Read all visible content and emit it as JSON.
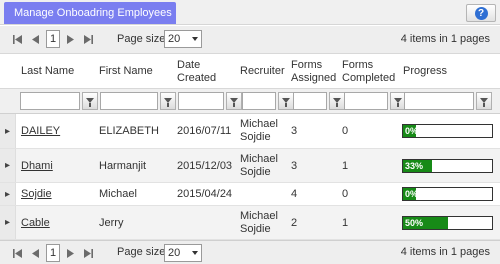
{
  "title_tab": "Manage Onboadring Employees",
  "pager": {
    "current_page": "1",
    "page_size_label": "Page size:",
    "page_size_value": "20",
    "info": "4 items in 1 pages"
  },
  "columns": {
    "last_name": "Last Name",
    "first_name": "First Name",
    "date_created_1": "Date",
    "date_created_2": "Created",
    "recruiter": "Recruiter",
    "forms_assigned_1": "Forms",
    "forms_assigned_2": "Assigned",
    "forms_completed_1": "Forms",
    "forms_completed_2": "Completed",
    "progress": "Progress"
  },
  "rows": [
    {
      "last_name": "DAILEY",
      "first_name": "ELIZABETH",
      "date_created": "2016/07/11",
      "recruiter_1": "Michael",
      "recruiter_2": "Sojdie",
      "forms_assigned": "3",
      "forms_completed": "0",
      "progress_label": "0%",
      "progress_fraction": 0.0
    },
    {
      "last_name": "Dhami",
      "first_name": "Harmanjit",
      "date_created": "2015/12/03",
      "recruiter_1": "Michael",
      "recruiter_2": "Sojdie",
      "forms_assigned": "3",
      "forms_completed": "1",
      "progress_label": "33%",
      "progress_fraction": 0.33
    },
    {
      "last_name": "Sojdie",
      "first_name": "Michael",
      "date_created": "2015/04/24",
      "recruiter_1": "",
      "recruiter_2": "",
      "forms_assigned": "4",
      "forms_completed": "0",
      "progress_label": "0%",
      "progress_fraction": 0.0
    },
    {
      "last_name": "Cable",
      "first_name": "Jerry",
      "date_created": "",
      "recruiter_1": "Michael",
      "recruiter_2": "Sojdie",
      "forms_assigned": "2",
      "forms_completed": "1",
      "progress_label": "50%",
      "progress_fraction": 0.5
    }
  ],
  "colors": {
    "title_tab": "#7a7ef0",
    "progress_fill": "#178a17"
  },
  "icons": {
    "help": "question-icon",
    "first": "first-page-icon",
    "prev": "prev-page-icon",
    "next": "next-page-icon",
    "last": "last-page-icon",
    "filter": "filter-icon",
    "expand": "expand-arrow-icon"
  }
}
